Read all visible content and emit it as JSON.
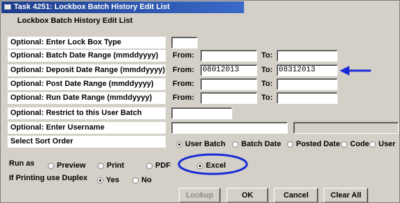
{
  "window": {
    "title": "Task 4251: Lockbox Batch History Edit List",
    "subtitle": "Lockbox Batch History Edit List"
  },
  "rows": [
    {
      "label": "Optional: Enter Lock Box Type"
    },
    {
      "label": "Optional: Batch Date Range (mmddyyyy)",
      "from_label": "From:",
      "from_value": "",
      "to_label": "To:",
      "to_value": ""
    },
    {
      "label": "Optional: Deposit Date Range (mmddyyyy)",
      "from_label": "From:",
      "from_value": "08012013",
      "to_label": "To:",
      "to_value": "08312013"
    },
    {
      "label": "Optional: Post Date Range (mmddyyyy)",
      "from_label": "From:",
      "from_value": "",
      "to_label": "To:",
      "to_value": ""
    },
    {
      "label": "Optional: Run Date Range (mmddyyyy)",
      "from_label": "From:",
      "from_value": "",
      "to_label": "To:",
      "to_value": ""
    },
    {
      "label": "Optional: Restrict to this User Batch"
    },
    {
      "label": "Optional:  Enter Username"
    },
    {
      "label": "Select Sort Order"
    }
  ],
  "sort_order": {
    "options": [
      "User Batch",
      "Batch Date",
      "Posted Date",
      "Code",
      "User"
    ],
    "selected": "User Batch"
  },
  "run_as": {
    "label": "Run as",
    "options": [
      "Preview",
      "Print",
      "PDF",
      "Excel"
    ],
    "selected": "Excel"
  },
  "duplex": {
    "label": "If Printing use Duplex",
    "options": [
      "Yes",
      "No"
    ],
    "selected": "Yes"
  },
  "buttons": {
    "lookup": "Lookup",
    "ok": "OK",
    "cancel": "Cancel",
    "clear_all": "Clear All"
  },
  "annotation": {
    "arrow_color": "#1a2bd6",
    "circle_color": "#1a2bd6"
  }
}
